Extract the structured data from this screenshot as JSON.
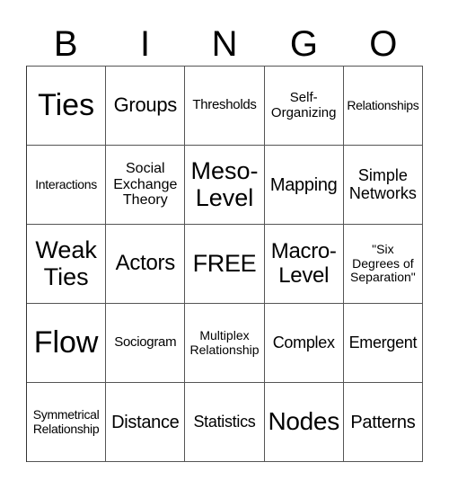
{
  "header": [
    "B",
    "I",
    "N",
    "G",
    "O"
  ],
  "cells": [
    "Ties",
    "Groups",
    "Thresholds",
    "Self-\nOrganizing",
    "Relationships",
    "Interactions",
    "Social\nExchange\nTheory",
    "Meso-\nLevel",
    "Mapping",
    "Simple\nNetworks",
    "Weak\nTies",
    "Actors",
    "FREE",
    "Macro-\nLevel",
    "\"Six\nDegrees of\nSeparation\"",
    "Flow",
    "Sociogram",
    "Multiplex\nRelationship",
    "Complex",
    "Emergent",
    "Symmetrical\nRelationship",
    "Distance",
    "Statistics",
    "Nodes",
    "Patterns"
  ]
}
